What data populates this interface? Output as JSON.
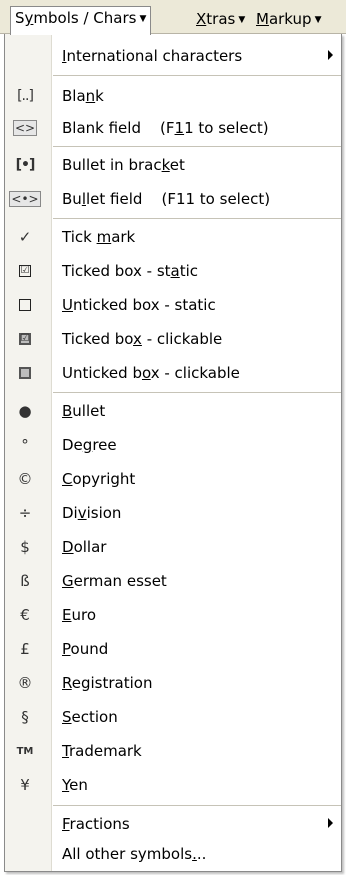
{
  "menubar": {
    "items": [
      {
        "pre": "S",
        "ul": "y",
        "post": "mbols / Chars"
      },
      {
        "pre": "",
        "ul": "X",
        "post": "tras"
      },
      {
        "pre": "",
        "ul": "M",
        "post": "arkup"
      }
    ],
    "caret": "▼"
  },
  "menu": {
    "items": [
      {
        "icon": "",
        "icon_name": "none",
        "pre": "",
        "ul": "I",
        "post": "nternational characters",
        "submenu": true
      },
      {
        "icon": "[..]",
        "icon_name": "blank-bracket-icon",
        "pre": "Bla",
        "ul": "n",
        "post": "k"
      },
      {
        "icon": "<>",
        "icon_name": "blank-field-icon",
        "pre": "Blank field    (F",
        "ul": "1",
        "post": "1 to select)"
      },
      {
        "icon": "[•]",
        "icon_name": "bullet-bracket-icon",
        "pre": "Bullet in brac",
        "ul": "k",
        "post": "et"
      },
      {
        "icon": "<•>",
        "icon_name": "bullet-field-icon",
        "pre": "Bu",
        "ul": "l",
        "post": "let field    (F11 to select)"
      },
      {
        "icon": "✓",
        "icon_name": "tick-mark-icon",
        "pre": "Tick ",
        "ul": "m",
        "post": "ark"
      },
      {
        "icon": "☑",
        "icon_name": "ticked-box-icon",
        "pre": "Ticked box - st",
        "ul": "a",
        "post": "tic"
      },
      {
        "icon": "☐",
        "icon_name": "unticked-box-icon",
        "pre": "",
        "ul": "U",
        "post": "nticked box - static"
      },
      {
        "icon": "☑",
        "icon_name": "ticked-box-clickable-icon",
        "pre": "Ticked bo",
        "ul": "x",
        "post": " - clickable"
      },
      {
        "icon": "☐",
        "icon_name": "unticked-box-clickable-icon",
        "pre": "Unticked b",
        "ul": "o",
        "post": "x - clickable"
      },
      {
        "icon": "●",
        "icon_name": "bullet-icon",
        "pre": "",
        "ul": "B",
        "post": "ullet"
      },
      {
        "icon": "°",
        "icon_name": "degree-icon",
        "pre": "De",
        "ul": "g",
        "post": "ree"
      },
      {
        "icon": "©",
        "icon_name": "copyright-icon",
        "pre": "",
        "ul": "C",
        "post": "opyright"
      },
      {
        "icon": "÷",
        "icon_name": "division-icon",
        "pre": "Di",
        "ul": "v",
        "post": "ision"
      },
      {
        "icon": "$",
        "icon_name": "dollar-icon",
        "pre": "",
        "ul": "D",
        "post": "ollar"
      },
      {
        "icon": "ß",
        "icon_name": "german-esset-icon",
        "pre": "",
        "ul": "G",
        "post": "erman esset"
      },
      {
        "icon": "€",
        "icon_name": "euro-icon",
        "pre": "",
        "ul": "E",
        "post": "uro"
      },
      {
        "icon": "£",
        "icon_name": "pound-icon",
        "pre": "",
        "ul": "P",
        "post": "ound"
      },
      {
        "icon": "®",
        "icon_name": "registration-icon",
        "pre": "",
        "ul": "R",
        "post": "egistration"
      },
      {
        "icon": "§",
        "icon_name": "section-icon",
        "pre": "",
        "ul": "S",
        "post": "ection"
      },
      {
        "icon": "TM",
        "icon_name": "trademark-icon",
        "pre": "",
        "ul": "T",
        "post": "rademark"
      },
      {
        "icon": "¥",
        "icon_name": "yen-icon",
        "pre": "",
        "ul": "Y",
        "post": "en"
      },
      {
        "icon": "",
        "icon_name": "none",
        "pre": "",
        "ul": "F",
        "post": "ractions",
        "submenu": true
      },
      {
        "icon": "",
        "icon_name": "none",
        "pre": "All other symbols",
        "ul": ".",
        "post": ".."
      }
    ]
  }
}
